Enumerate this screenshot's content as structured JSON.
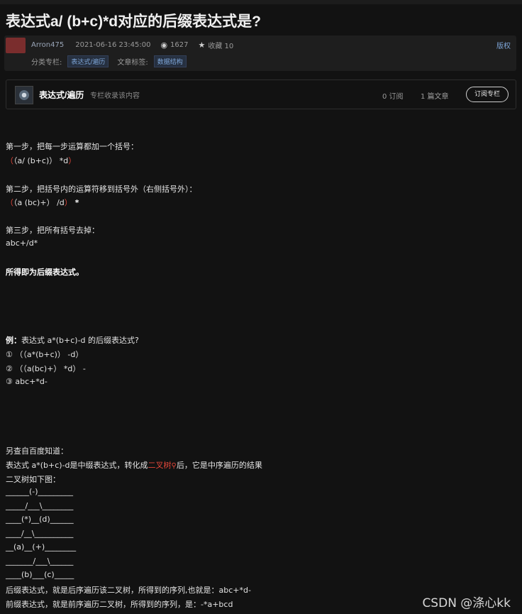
{
  "article": {
    "title": "表达式a/ (b+c)*d对应的后缀表达式是?",
    "author": "Arron475",
    "date": "2021-06-16 23:45:00",
    "views": "1627",
    "favorites": "收藏 10",
    "copyright": "版权",
    "category_label": "分类专栏:",
    "category_tag": "表达式/遍历",
    "tags_label": "文章标签:",
    "tag": "数据结构"
  },
  "column": {
    "name": "表达式/遍历",
    "desc": "专栏收录该内容",
    "subs": "0 订阅",
    "posts": "1 篇文章",
    "subscribe_btn": "订阅专栏"
  },
  "content": {
    "step1": "第一步，把每一步运算都加一个括号：",
    "step1_open": "（",
    "step1_expr": "（a/ (b+c)） *d",
    "step1_close": "）",
    "step2": "第二步，把括号内的运算符移到括号外（右侧括号外）：",
    "step2_open": "（",
    "step2_expr": "（a (bc)+） /d",
    "step2_close": "）",
    "step2_tail": " *",
    "step3": "第三步，把所有括号去掉：",
    "step3_expr": "abc+/d*",
    "conclusion": "所得即为后缀表达式。",
    "example_label": "例：",
    "example_text": "表达式 a*(b+c)-d 的后缀表达式?",
    "ex1": "①    （（a*(b+c)） -d）",
    "ex2": "②    （（a(bc)+） *d） -",
    "ex3": "③      abc+*d-",
    "also": "另查自百度知道：",
    "baidu_pre": "表达式 a*(b+c)-d是中缀表达式，转化成",
    "baidu_link": "二叉树",
    "baidu_post": "后，它是中序遍历的结果",
    "tree_title": "二叉树如下图：",
    "tree": [
      "______(-)_________",
      "_____/___\\________",
      "____(*)__(d)______",
      "____/__\\__________",
      "__(a)__(+)________",
      "_______/___\\______",
      "____(b)___(c)_____"
    ],
    "postfix_line": "后缀表达式，就是后序遍历该二叉树，所得到的序列,也就是：abc+*d-",
    "prefix_line": "前缀表达式，就是前序遍历二叉树，所得到的序列，是：-*a+bcd"
  },
  "watermark": "CSDN @涤心kk",
  "icons": {
    "views": "eye-icon",
    "favorites": "star-icon",
    "search": "search-icon"
  }
}
